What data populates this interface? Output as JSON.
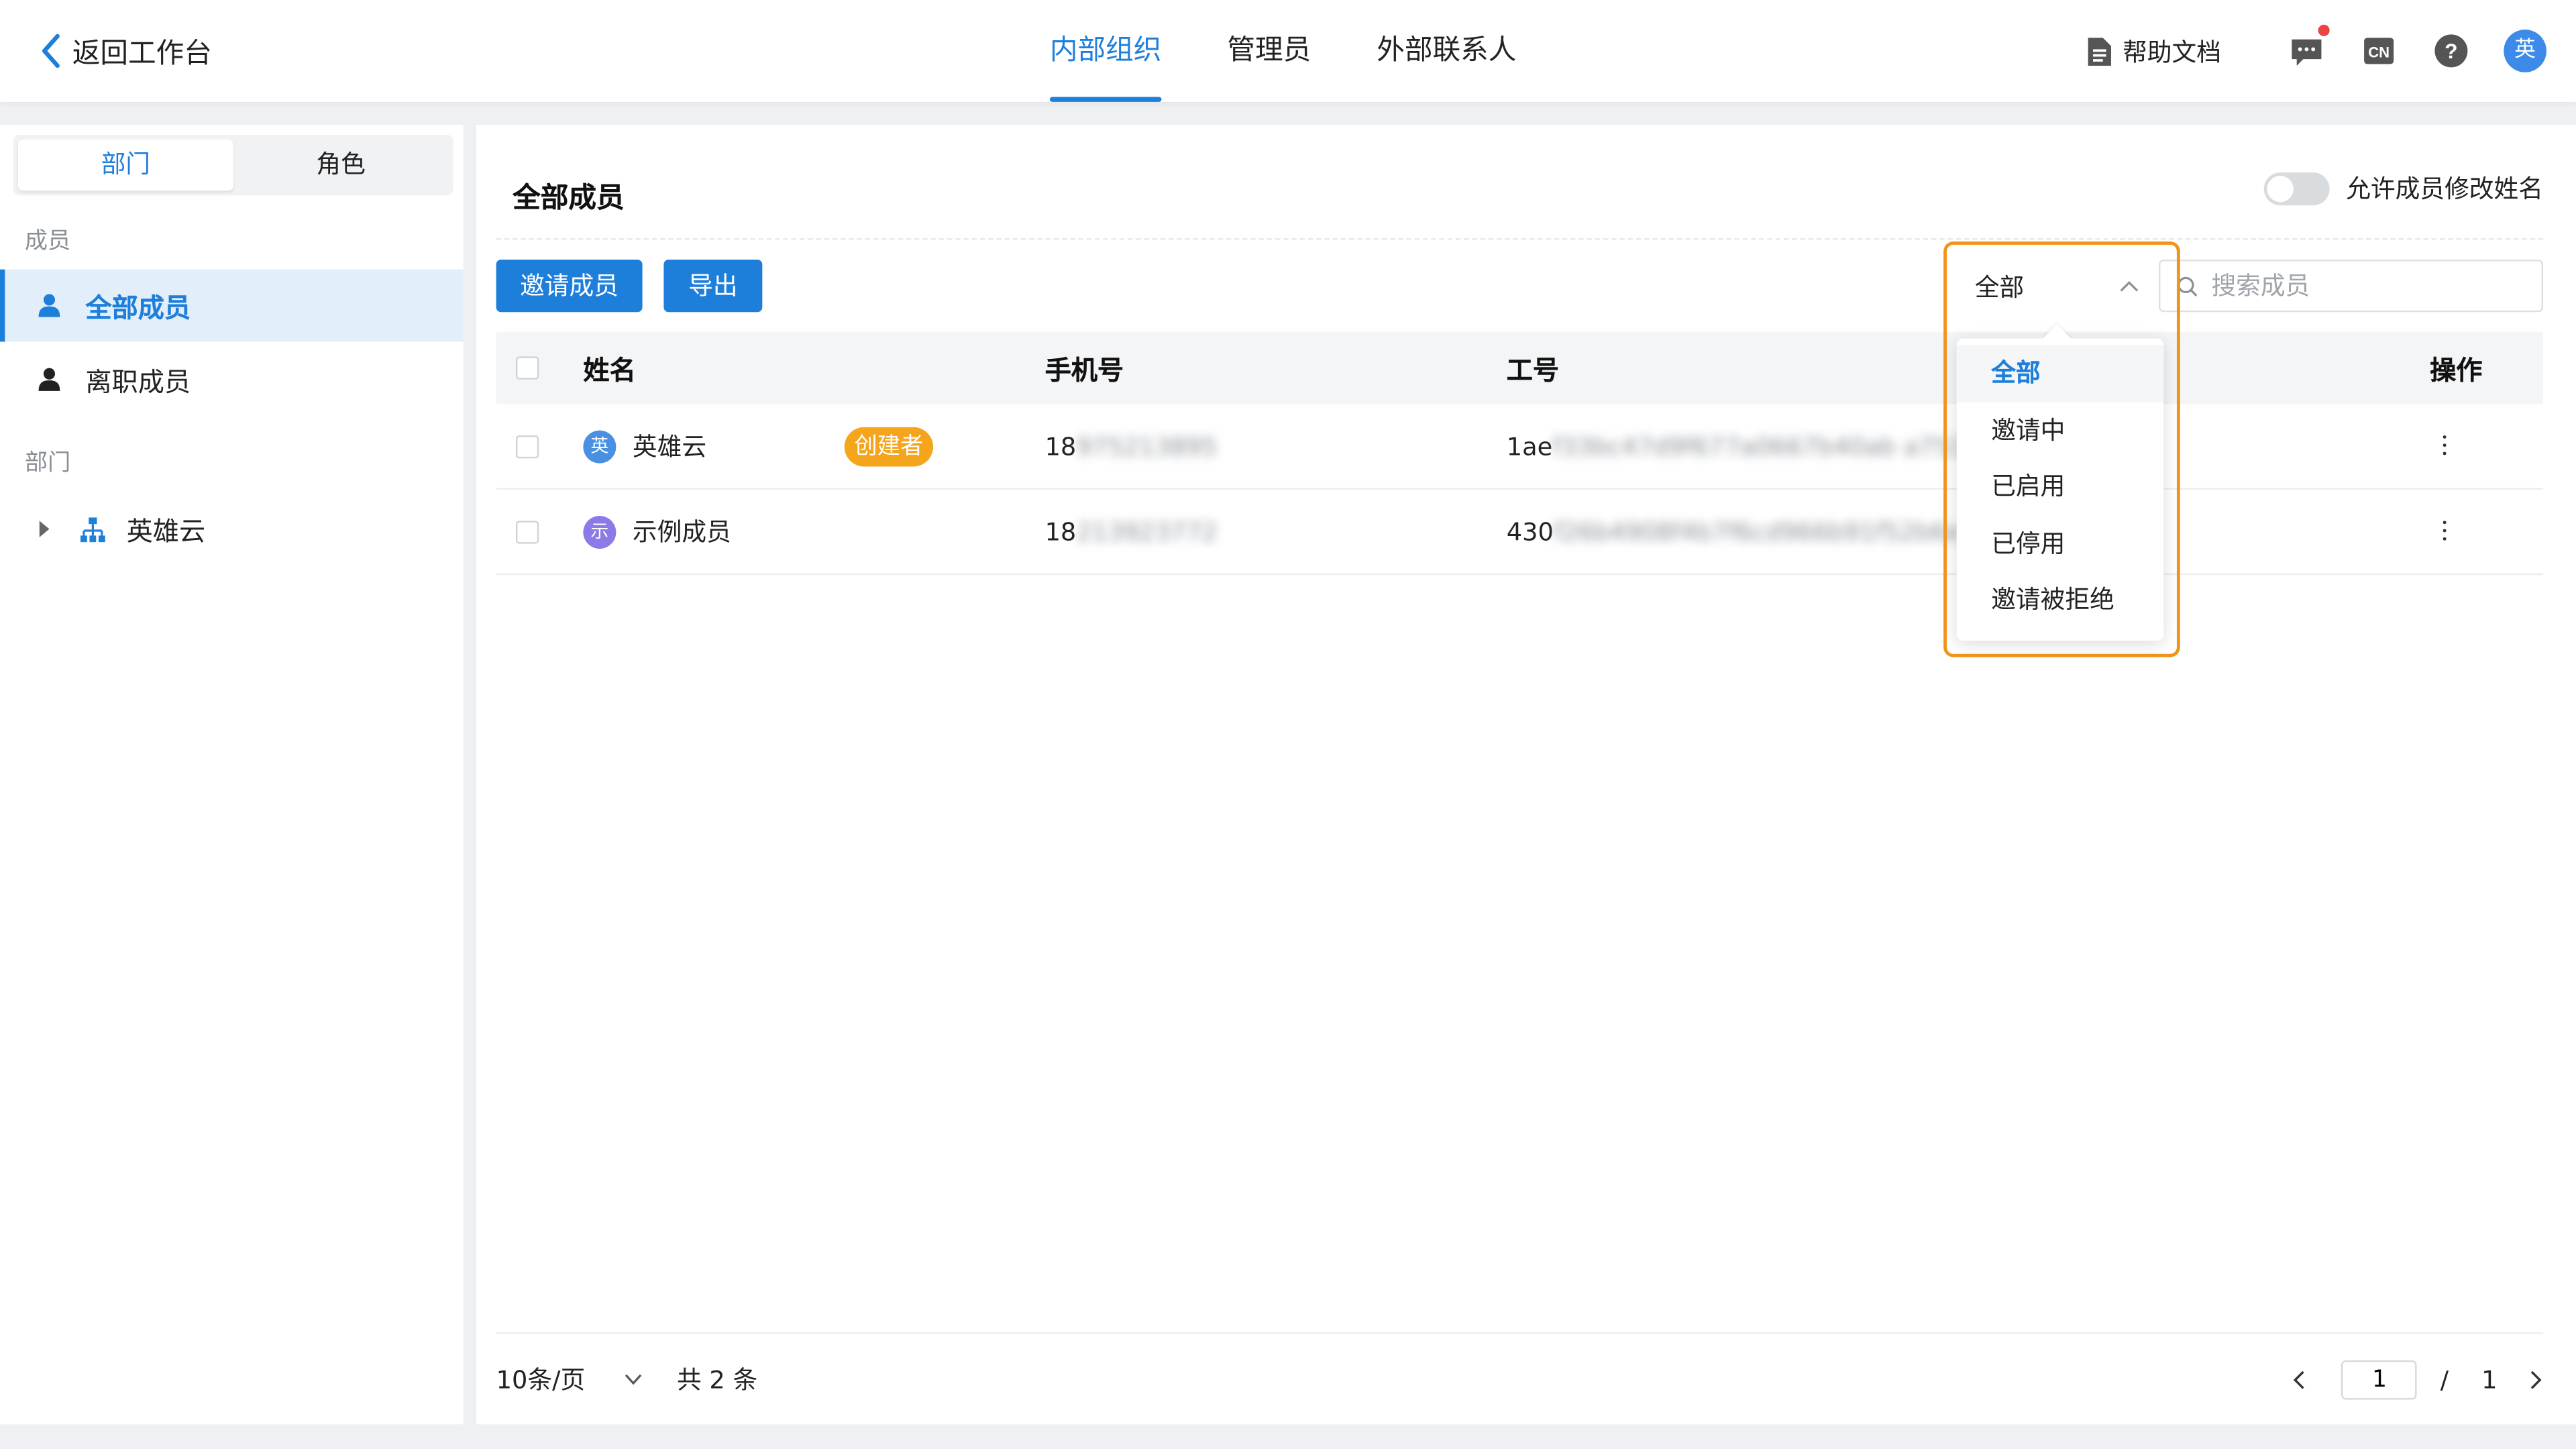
{
  "header": {
    "back_label": "返回工作台",
    "tabs": [
      {
        "label": "内部组织",
        "active": true
      },
      {
        "label": "管理员",
        "active": false
      },
      {
        "label": "外部联系人",
        "active": false
      }
    ],
    "help_label": "帮助文档",
    "avatar_text": "英",
    "icons": [
      "document-icon",
      "message-icon",
      "language-cn-icon",
      "help-icon"
    ]
  },
  "sidebar": {
    "seg_tabs": [
      "部门",
      "角色"
    ],
    "members_label": "成员",
    "items": [
      {
        "label": "全部成员",
        "active": true
      },
      {
        "label": "离职成员",
        "active": false
      }
    ],
    "dept_label": "部门",
    "dept_root": "英雄云"
  },
  "main": {
    "title": "全部成员",
    "toggle_label": "允许成员修改姓名",
    "toggle_on": false,
    "buttons": {
      "invite": "邀请成员",
      "export": "导出"
    },
    "search_placeholder": "搜索成员",
    "status_select": {
      "value": "全部",
      "options": [
        "全部",
        "邀请中",
        "已启用",
        "已停用",
        "邀请被拒绝"
      ]
    },
    "table": {
      "headers": {
        "name": "姓名",
        "phone": "手机号",
        "id": "工号",
        "op": "操作"
      },
      "rows": [
        {
          "avatar": "英",
          "avatar_color": "#4a90e2",
          "name": "英雄云",
          "badge": "创建者",
          "phone_prefix": "18",
          "phone_hidden": "975213895",
          "id_prefix": "1ae",
          "id_hidden": "f33bc47d9f677a0667b40ab a7511"
        },
        {
          "avatar": "示",
          "avatar_color": "#8c7ae6",
          "name": "示例成员",
          "badge": "",
          "phone_prefix": "18",
          "phone_hidden": "213923772",
          "id_prefix": "430",
          "id_hidden": "f26b4908f4b7f6cd966b91f52b6e"
        }
      ]
    }
  },
  "pagination": {
    "page_size": "10条/页",
    "total": "共 2 条",
    "current": "1",
    "slash": "/",
    "pages": "1"
  },
  "colors": {
    "accent": "#1e7fdb",
    "badge": "#f4a51c",
    "highlight_border": "#f0941c"
  }
}
